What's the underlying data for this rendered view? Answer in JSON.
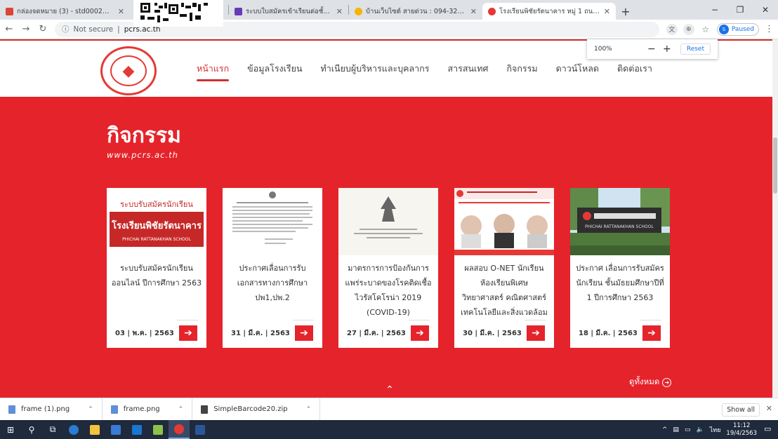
{
  "browser": {
    "tabs": [
      {
        "label": "กล่องจดหมาย (3) - std0002@pcrs.",
        "color": "#db4437"
      },
      {
        "label": "",
        "color": "#cccccc"
      },
      {
        "label": "ระบบใบสมัครเข้าเรียนต่อชั้นมัธยมศึกษ",
        "color": "#673ab7"
      },
      {
        "label": "บ้านเว็บไซต์ สายด่วน : 094-326-652",
        "color": "#f4b400"
      },
      {
        "label": "โรงเรียนพิชัยรัตนาคาร หมู่ 1 ถนนเพชร",
        "color": "#e53935",
        "active": true
      }
    ],
    "new_tab": "+",
    "url_security": "Not secure",
    "url": "pcrs.ac.th",
    "profile_label": "Paused",
    "profile_initial": "S",
    "window_controls": [
      "−",
      "❐",
      "✕"
    ]
  },
  "zoom_popup": {
    "level": "100%",
    "minus": "−",
    "plus": "+",
    "reset": "Reset"
  },
  "site": {
    "menu": [
      {
        "label": "หน้าแรก",
        "active": true
      },
      {
        "label": "ข้อมูลโรงเรียน"
      },
      {
        "label": "ทำเนียบผู้บริหารและบุคลากร"
      },
      {
        "label": "สารสนเทศ"
      },
      {
        "label": "กิจกรรม"
      },
      {
        "label": "ดาวน์โหลด"
      },
      {
        "label": "ติดต่อเรา"
      }
    ],
    "activity": {
      "title": "กิจกรรม",
      "url": "www.pcrs.ac.th",
      "see_all": "ดูทั้งหมด",
      "cards": [
        {
          "title": "ระบบรับสมัครนักเรียนออนไลน์ ปีการศึกษา 2563",
          "date": "03 | พ.ค. | 2563",
          "thumb_text": "ระบบรับสมัครนักเรียน โรงเรียนพิชัยรัตนาคาร",
          "thumb_sub": "PHICHAI RATTANAKHAN SCHOOL"
        },
        {
          "title": "ประกาศเลื่อนการรับเอกสารทางการศึกษา ปพ1,ปพ.2",
          "date": "31 | มี.ค. | 2563"
        },
        {
          "title": "มาตรการการป้องกันการแพร่ระบาดของโรคติดเชื้อไวรัสโคโรน่า 2019 (COVID-19)",
          "date": "27 | มี.ค. | 2563"
        },
        {
          "title": "ผลสอบ O-NET นักเรียนห้องเรียนพิเศษ วิทยาศาสตร์ คณิตศาสตร์ เทคโนโลยีและสิ่งแวดล้อม",
          "date": "30 | มี.ค. | 2563"
        },
        {
          "title": "ประกาศ เลื่อนการรับสมัครนักเรียน ชั้นมัธยมศึกษาปีที่ 1 ปีการศึกษา 2563",
          "date": "18 | มี.ค. | 2563",
          "thumb_sub": "PHICHAI RATTANAKHAN SCHOOL"
        }
      ]
    }
  },
  "downloads": {
    "items": [
      "frame (1).png",
      "frame.png",
      "SimpleBarcode20.zip"
    ],
    "show_all": "Show all"
  },
  "taskbar": {
    "lang": "ไทย",
    "time": "11:12",
    "date": "19/4/2563"
  }
}
